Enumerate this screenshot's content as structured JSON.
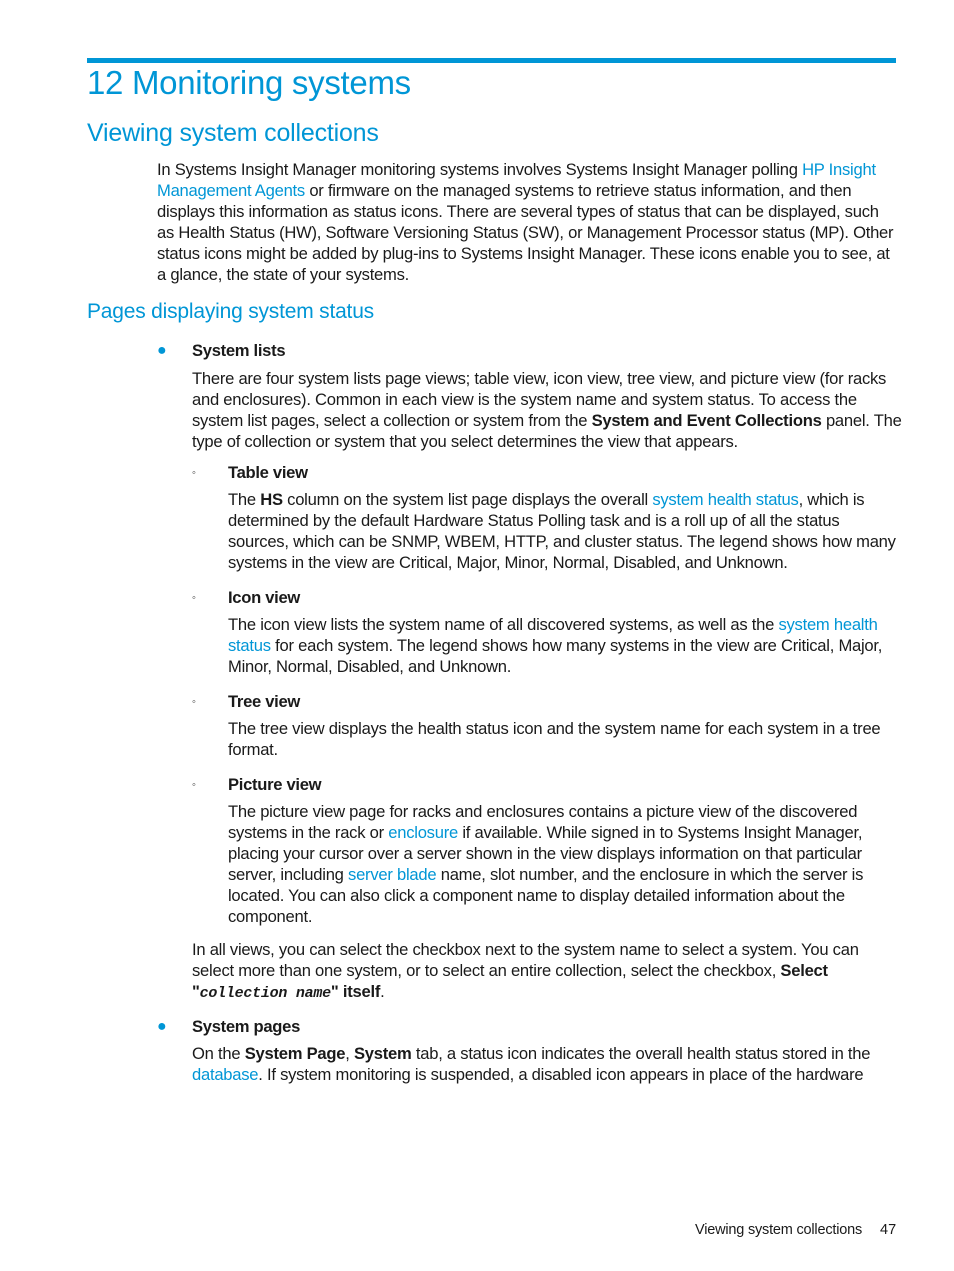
{
  "chapter": {
    "number": "12",
    "title": "12 Monitoring systems"
  },
  "section": {
    "title": "Viewing system collections"
  },
  "intro": {
    "t1": "In Systems Insight Manager monitoring systems involves Systems Insight Manager polling ",
    "link1": "HP Insight Management Agents",
    "t2": " or firmware on the managed systems to retrieve status information, and then displays this information as status icons. There are several types of status that can be displayed, such as Health Status (HW), Software Versioning Status (SW), or Management Processor status (MP). Other status icons might be added by plug-ins to Systems Insight Manager. These icons enable you to see, at a glance, the state of your systems."
  },
  "subsection": {
    "title": "Pages displaying system status"
  },
  "system_lists": {
    "heading": "System lists",
    "p_t1": "There are four system lists page views; table view, icon view, tree view, and picture view (for racks and enclosures). Common in each view is the system name and system status. To access the system list pages, select a collection or system from the ",
    "p_bold": "System and Event Collections",
    "p_t2": " panel. The type of collection or system that you select determines the view that appears.",
    "table_view": {
      "heading": "Table view",
      "t1": "The ",
      "bold": "HS",
      "t2": " column on the system list page displays the overall ",
      "link": "system health status",
      "t3": ", which is determined by the default Hardware Status Polling task and is a roll up of all the status sources, which can be SNMP, WBEM, HTTP, and cluster status. The legend shows how many systems in the view are Critical, Major, Minor, Normal, Disabled, and Unknown."
    },
    "icon_view": {
      "heading": "Icon view",
      "t1": "The icon view lists the system name of all discovered systems, as well as the ",
      "link": "system health status",
      "t2": " for each system. The legend shows how many systems in the view are Critical, Major, Minor, Normal, Disabled, and Unknown."
    },
    "tree_view": {
      "heading": "Tree view",
      "text": "The tree view displays the health status icon and the system name for each system in a tree format."
    },
    "picture_view": {
      "heading": "Picture view",
      "t1": "The picture view page for racks and enclosures contains a picture view of the discovered systems in the rack or ",
      "link1": "enclosure",
      "t2": " if available. While signed in to Systems Insight Manager, placing your cursor over a server shown in the view displays information on that particular server, including ",
      "link2": "server blade",
      "t3": " name, slot number, and the enclosure in which the server is located. You can also click a component name to display detailed information about the component."
    },
    "all_views": {
      "t1": "In all views, you can select the checkbox next to the system name to select a system. You can select more than one system, or to select an entire collection, select the checkbox, ",
      "bold1": "Select",
      "t2": " ",
      "q1": "\"",
      "mono": "collection name",
      "q2": "\"",
      "bold2": " itself",
      "t3": "."
    }
  },
  "system_pages": {
    "heading": "System pages",
    "t1": "On the ",
    "bold1": "System Page",
    "t2": ", ",
    "bold2": "System",
    "t3": " tab, a status icon indicates the overall health status stored in the ",
    "link": "database",
    "t4": ". If system monitoring is suspended, a disabled icon appears in place of the hardware"
  },
  "footer": {
    "label": "Viewing system collections",
    "page": "47"
  },
  "colors": {
    "accent": "#0096d6",
    "text": "#1a1a1a"
  }
}
